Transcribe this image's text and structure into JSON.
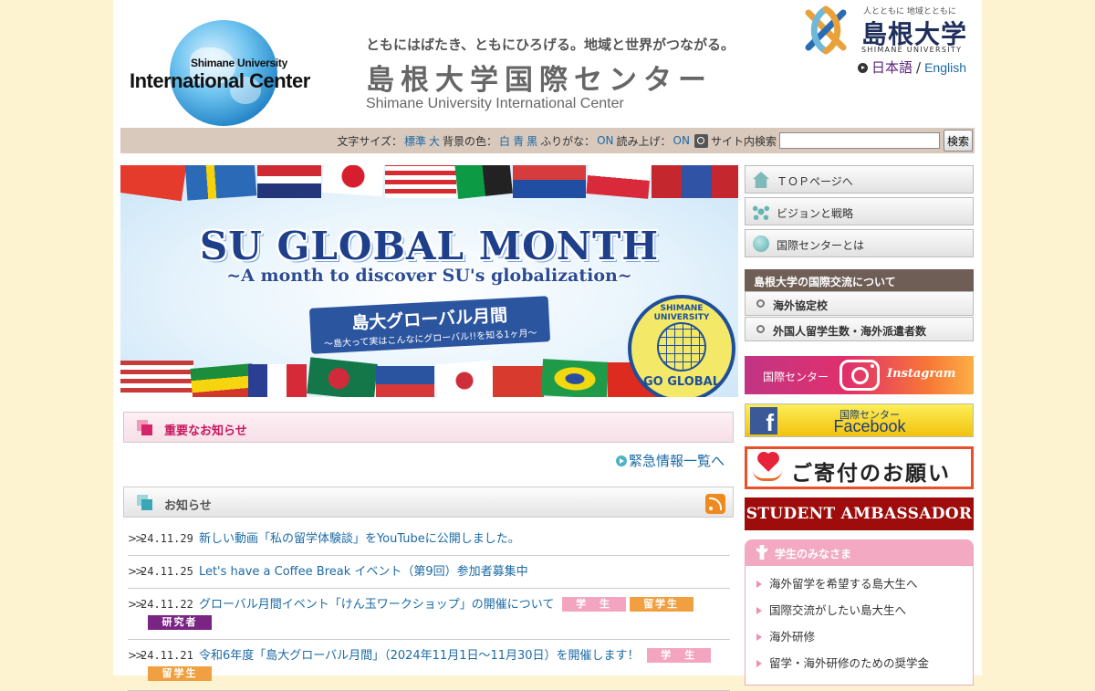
{
  "header": {
    "logo_small": "Shimane University",
    "logo_big": "International Center",
    "tagline": "ともにはばたき、ともにひろげる。地域と世界がつながる。",
    "title_jp": "島根大学国際センター",
    "title_en": "Shimane University International Center",
    "univ_motto": "人とともに 地域とともに",
    "univ_name": "島根大学",
    "univ_name_en": "SHIMANE UNIVERSITY",
    "lang_jp": "日本語",
    "lang_sep": "/",
    "lang_en": "English"
  },
  "toolbar": {
    "font_size_label": "文字サイズ：",
    "font_standard": "標準",
    "font_large": "大",
    "bg_label": "背景の色：",
    "bg_white": "白",
    "bg_blue": "青",
    "bg_black": "黒",
    "furigana_label": "ふりがな：",
    "furigana_on": "ON",
    "readout_label": "読み上げ：",
    "readout_on": "ON",
    "search_label": "サイト内検索",
    "search_value": "",
    "search_button": "検索"
  },
  "banner": {
    "title": "SU GLOBAL MONTH",
    "subtitle": "~A month to discover SU's globalization~",
    "ribbon_main": "島大グローバル月間",
    "ribbon_sub": "～島大って実はこんなにグローバル!!を知る1ヶ月～",
    "seal_top": "SHIMANE UNIVERSITY",
    "seal_bottom": "GO GLOBAL"
  },
  "important": {
    "title": "重要なお知らせ",
    "emergency_link": "緊急情報一覧へ"
  },
  "news": {
    "title": "お知らせ",
    "items": [
      {
        "date": "24.11.29",
        "title": "新しい動画「私の留学体験談」をYouTubeに公開しました。",
        "badges": []
      },
      {
        "date": "24.11.25",
        "title": "Let's have a Coffee Break イベント（第9回）参加者募集中",
        "badges": []
      },
      {
        "date": "24.11.22",
        "title": "グローバル月間イベント「けん玉ワークショップ」の開催について",
        "badges": [
          "学　生",
          "留学生",
          "研究者"
        ]
      },
      {
        "date": "24.11.21",
        "title": "令和6年度「島大グローバル月間」（2024年11月1日～11月30日）を開催します！",
        "badges": [
          "学　生",
          "留学生"
        ]
      }
    ]
  },
  "sidebar": {
    "nav": [
      {
        "label": "ＴＯＰページへ"
      },
      {
        "label": "ビジョンと戦略"
      },
      {
        "label": "国際センターとは"
      }
    ],
    "intl_header": "島根大学の国際交流について",
    "intl_items": [
      {
        "label": "海外協定校"
      },
      {
        "label": "外国人留学生数・海外派遣者数"
      }
    ],
    "instagram_left": "国際センター",
    "instagram_right": "Instagram",
    "facebook_top": "国際センター",
    "facebook_bottom": "Facebook",
    "facebook_logo": "f",
    "donate": "ご寄付のお願い",
    "ambassador": "STUDENT AMBASSADOR",
    "students_header": "学生のみなさま",
    "students_items": [
      {
        "label": "海外留学を希望する島大生へ"
      },
      {
        "label": "国際交流がしたい島大生へ"
      },
      {
        "label": "海外研修"
      },
      {
        "label": "留学・海外研修のための奨学金"
      }
    ]
  },
  "colors": {
    "accent_blue": "#1b6aa5",
    "important_pink": "#c8175d",
    "ambassador_red": "#9e0c0c",
    "badge_student": "#f3a5bf",
    "badge_intl": "#f0a040",
    "badge_researcher": "#7a2484"
  }
}
